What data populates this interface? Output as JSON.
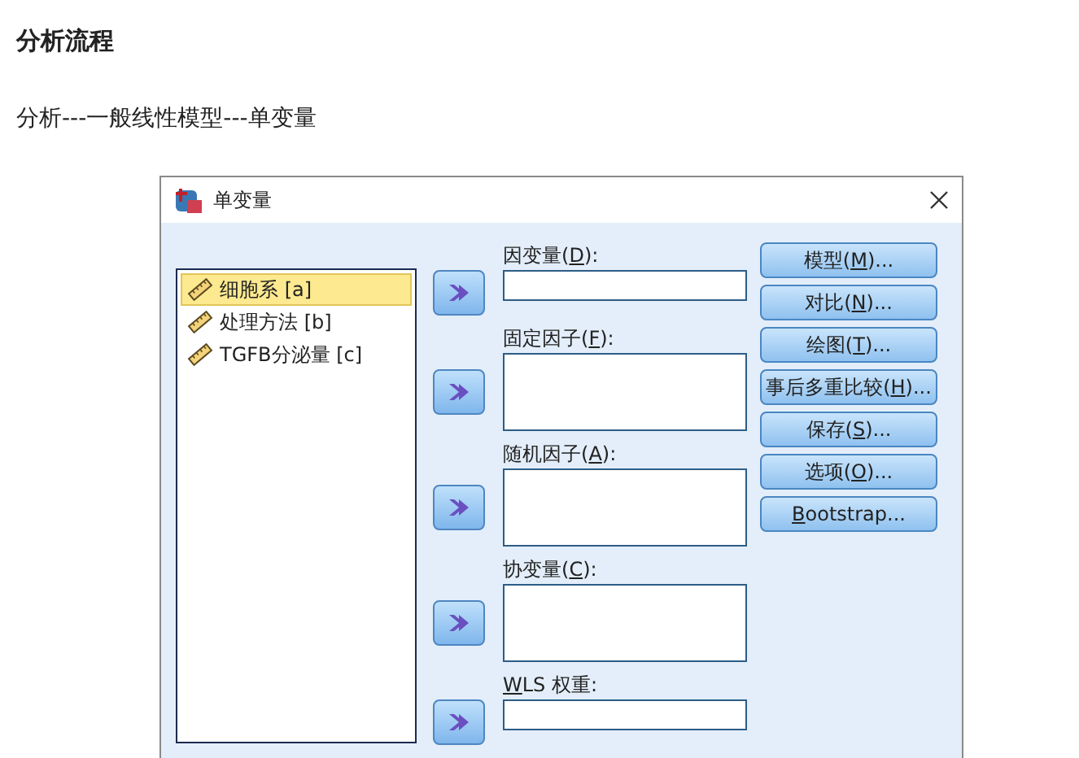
{
  "page": {
    "heading": "分析流程",
    "path": "分析---一般线性模型---单变量"
  },
  "dialog": {
    "title": "单变量",
    "variables": [
      {
        "name": "细胞系 [a]",
        "selected": true
      },
      {
        "name": "处理方法 [b]",
        "selected": false
      },
      {
        "name": "TGFB分泌量 [c]",
        "selected": false
      }
    ],
    "targets": [
      {
        "kind": "single",
        "label": [
          {
            "text": "因变量(",
            "underline": false
          },
          {
            "text": "D",
            "underline": true
          },
          {
            "text": "):",
            "underline": false
          }
        ]
      },
      {
        "kind": "list",
        "label": [
          {
            "text": "固定因子(",
            "underline": false
          },
          {
            "text": "F",
            "underline": true
          },
          {
            "text": "):",
            "underline": false
          }
        ]
      },
      {
        "kind": "list",
        "label": [
          {
            "text": "随机因子(",
            "underline": false
          },
          {
            "text": "A",
            "underline": true
          },
          {
            "text": "):",
            "underline": false
          }
        ]
      },
      {
        "kind": "list",
        "label": [
          {
            "text": "协变量(",
            "underline": false
          },
          {
            "text": "C",
            "underline": true
          },
          {
            "text": "):",
            "underline": false
          }
        ]
      },
      {
        "kind": "single",
        "label": [
          {
            "text": "W",
            "underline": true
          },
          {
            "text": "LS 权重:",
            "underline": false
          }
        ]
      }
    ],
    "buttons": [
      {
        "label": [
          {
            "text": "模型(",
            "underline": false
          },
          {
            "text": "M",
            "underline": true
          },
          {
            "text": ")...",
            "underline": false
          }
        ]
      },
      {
        "label": [
          {
            "text": "对比(",
            "underline": false
          },
          {
            "text": "N",
            "underline": true
          },
          {
            "text": ")...",
            "underline": false
          }
        ]
      },
      {
        "label": [
          {
            "text": "绘图(",
            "underline": false
          },
          {
            "text": "T",
            "underline": true
          },
          {
            "text": ")...",
            "underline": false
          }
        ]
      },
      {
        "label": [
          {
            "text": "事后多重比较(",
            "underline": false
          },
          {
            "text": "H",
            "underline": true
          },
          {
            "text": ")...",
            "underline": false
          }
        ]
      },
      {
        "label": [
          {
            "text": "保存(",
            "underline": false
          },
          {
            "text": "S",
            "underline": true
          },
          {
            "text": ")...",
            "underline": false
          }
        ]
      },
      {
        "label": [
          {
            "text": "选项(",
            "underline": false
          },
          {
            "text": "O",
            "underline": true
          },
          {
            "text": ")...",
            "underline": false
          }
        ]
      },
      {
        "label": [
          {
            "text": "B",
            "underline": true
          },
          {
            "text": "ootstrap...",
            "underline": false
          }
        ]
      }
    ]
  }
}
